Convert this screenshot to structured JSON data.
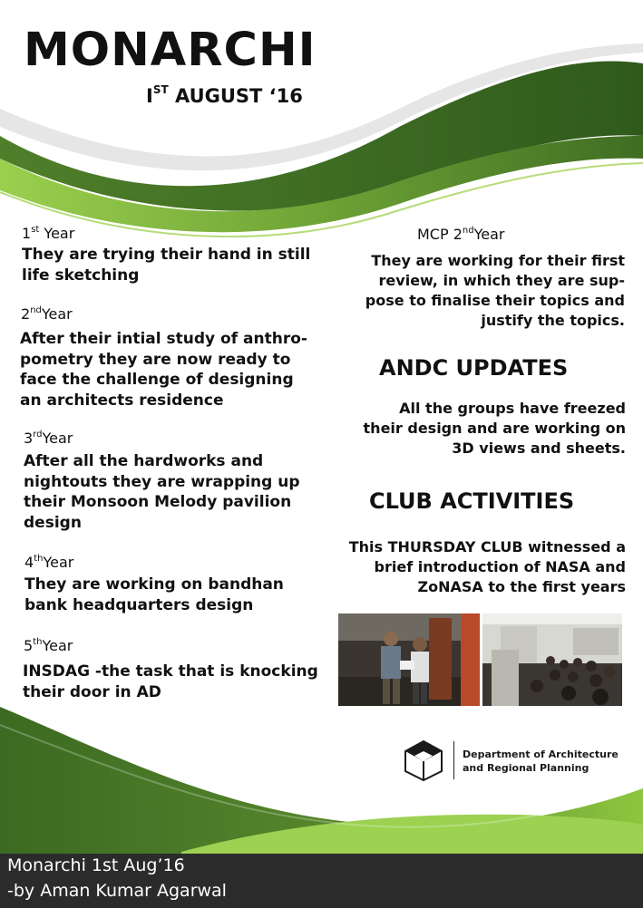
{
  "header": {
    "title": "MONARCHI",
    "date_ordinal": "I",
    "date_suffix": "ST",
    "date_rest": " AUGUST ‘16"
  },
  "years": [
    {
      "num": "1",
      "sup": "st",
      "label": " Year",
      "text": "They are trying their hand in still life sketching"
    },
    {
      "num": "2",
      "sup": "nd",
      "label": "Year",
      "text": "After their intial study of anthro-pometry they are now ready to face the challenge of designing an architects residence"
    },
    {
      "num": "3",
      "sup": "rd",
      "label": "Year",
      "text": "After all the hardworks and nightouts they are wrapping up their Monsoon Melody pavilion design"
    },
    {
      "num": "4",
      "sup": "th",
      "label": "Year",
      "text": "They are working on bandhan bank headquarters design"
    },
    {
      "num": "5",
      "sup": "th",
      "label": "Year",
      "text": "INSDAG -the  task that is knocking their door in AD"
    }
  ],
  "mcp": {
    "head_prefix": "MCP 2",
    "head_sup": "nd",
    "head_suffix": "Year",
    "text": "They are working for their first review, in which they are sup-pose to finalise their topics and justify the topics."
  },
  "andc": {
    "heading": "ANDC UPDATES",
    "text": "All the groups have freezed their design and are working on 3D views and sheets."
  },
  "club": {
    "heading": "CLUB ACTIVITIES",
    "text": "This THURSDAY CLUB witnessed a brief introduction of NASA and ZoNASA to the first years"
  },
  "logo": {
    "icon": "cube-logo-icon",
    "dept_line1": "Department of Architecture",
    "dept_line2": "and Regional Planning"
  },
  "footer": {
    "line1": "Monarchi 1st Aug’16",
    "line2": "-by Aman Kumar Agarwal"
  },
  "colors": {
    "green_dark": "#3d6a23",
    "green_mid": "#5d8c2e",
    "green_light": "#8ec63f",
    "footer_bg": "#2b2b2b"
  }
}
